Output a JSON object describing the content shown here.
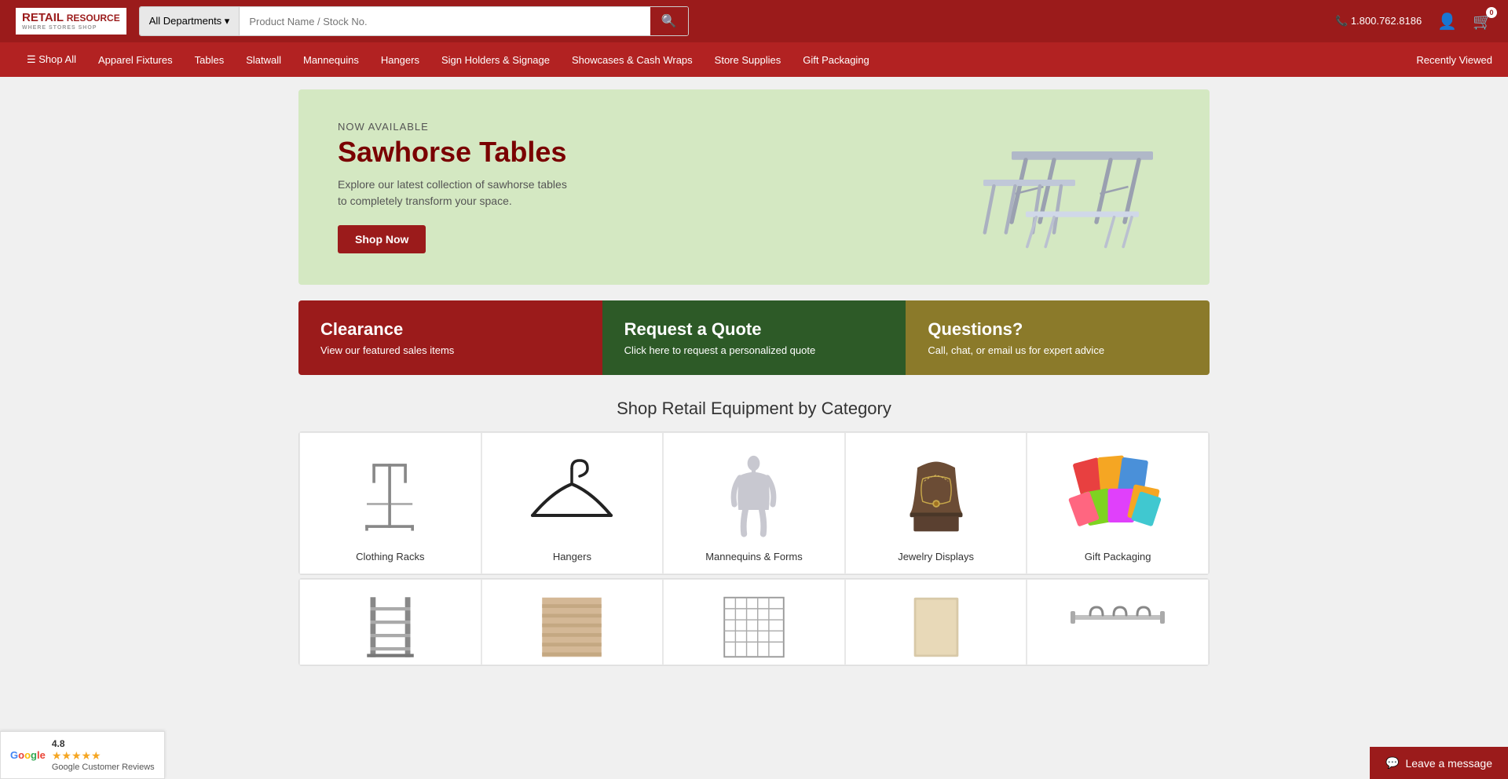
{
  "header": {
    "logo_line1": "RETAIL",
    "logo_line2": "RESOURCE",
    "logo_sub": "WHERE STORES SHOP",
    "phone": "1.800.762.8186",
    "search_placeholder": "Product Name / Stock No.",
    "dept_label": "All Departments",
    "cart_count": "0",
    "recently_viewed": "Recently Viewed"
  },
  "nav": {
    "shop_all": "☰ Shop All",
    "items": [
      "Apparel Fixtures",
      "Tables",
      "Slatwall",
      "Mannequins",
      "Hangers",
      "Sign Holders & Signage",
      "Showcases & Cash Wraps",
      "Store Supplies",
      "Gift Packaging"
    ]
  },
  "hero": {
    "now_available": "NOW AVAILABLE",
    "title": "Sawhorse Tables",
    "desc_line1": "Explore our latest collection of sawhorse tables",
    "desc_line2": "to completely transform your space.",
    "btn_label": "Shop Now"
  },
  "promos": [
    {
      "title": "Clearance",
      "desc": "View our featured sales items",
      "style": "clearance"
    },
    {
      "title": "Request a Quote",
      "desc": "Click here to request a personalized quote",
      "style": "quote"
    },
    {
      "title": "Questions?",
      "desc": "Call, chat, or email us for expert advice",
      "style": "questions"
    }
  ],
  "category_section_title": "Shop Retail Equipment by Category",
  "categories_row1": [
    {
      "label": "Clothing Racks",
      "icon": "clothing-rack"
    },
    {
      "label": "Hangers",
      "icon": "hanger"
    },
    {
      "label": "Mannequins & Forms",
      "icon": "mannequin"
    },
    {
      "label": "Jewelry Displays",
      "icon": "jewelry"
    },
    {
      "label": "Gift Packaging",
      "icon": "gift-packaging"
    }
  ],
  "categories_row2": [
    {
      "label": "",
      "icon": "fixture2-1"
    },
    {
      "label": "",
      "icon": "fixture2-2"
    },
    {
      "label": "",
      "icon": "fixture2-3"
    },
    {
      "label": "",
      "icon": "fixture2-4"
    },
    {
      "label": "",
      "icon": "fixture2-5"
    }
  ],
  "google_reviews": {
    "rating": "4.8",
    "stars": "★★★★★",
    "label": "Google Customer Reviews"
  },
  "leave_message": {
    "label": "Leave a message",
    "icon": "chat-icon"
  }
}
